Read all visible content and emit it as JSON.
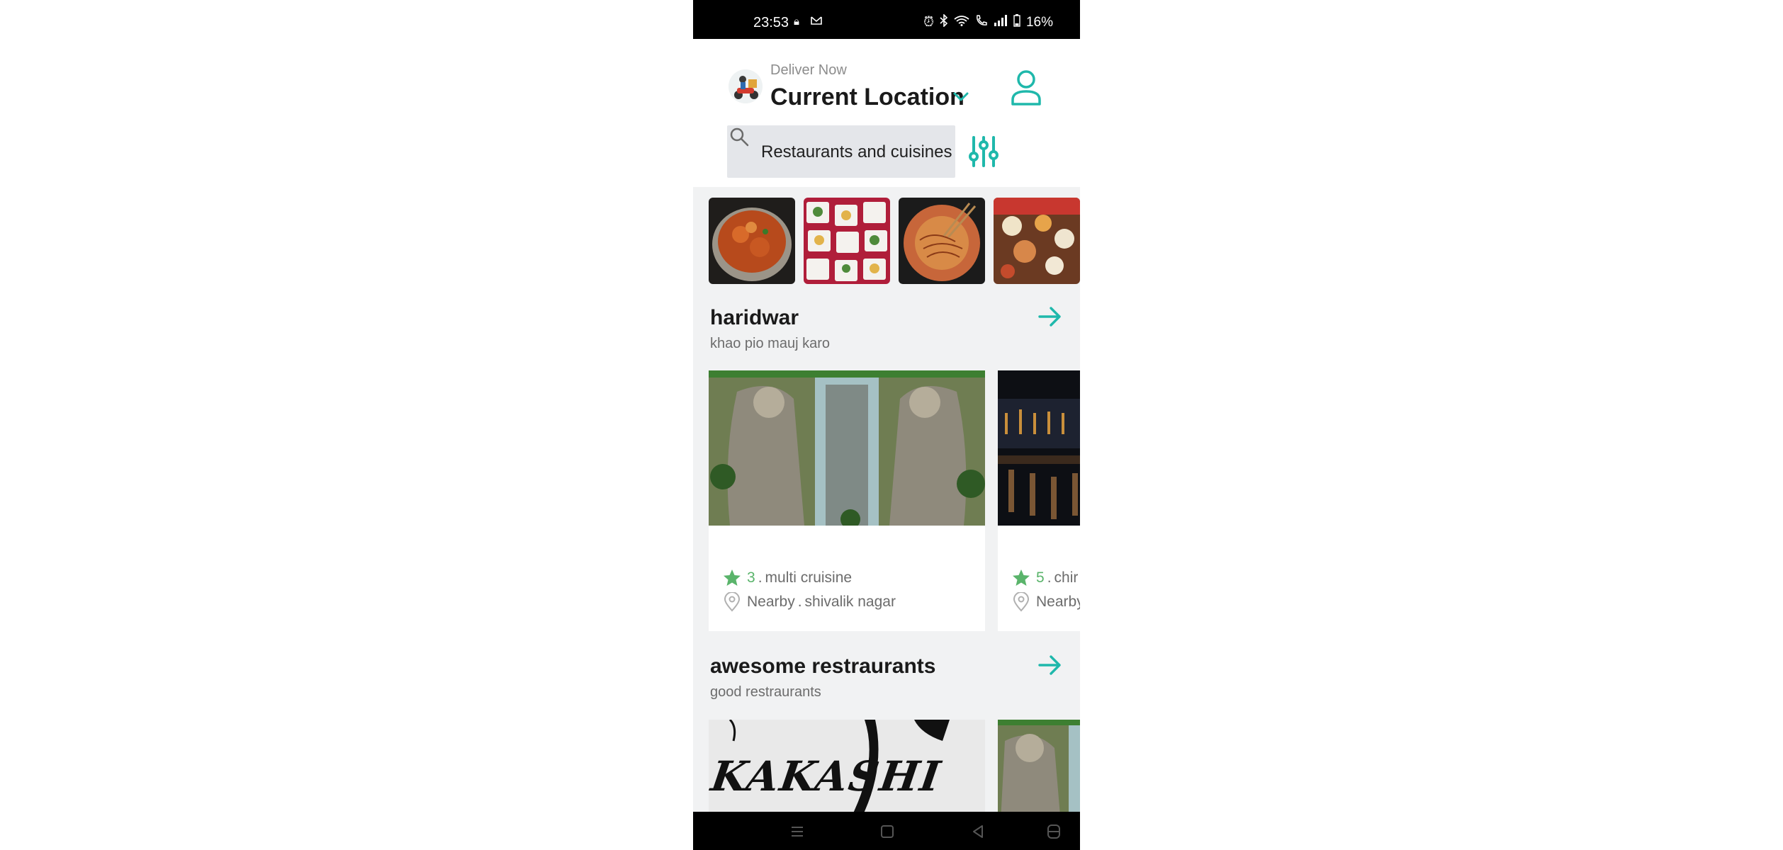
{
  "status_bar": {
    "time": "23:53",
    "battery": "16%",
    "icons": [
      "lock-icon",
      "mail-icon",
      "alarm-icon",
      "bluetooth-icon",
      "wifi-icon",
      "call-icon",
      "signal-icon",
      "battery-icon"
    ]
  },
  "header": {
    "deliver_label": "Deliver Now",
    "location": "Current Location"
  },
  "search": {
    "placeholder": "Restaurants and cuisines"
  },
  "colors": {
    "accent": "#1fb8ab",
    "rating_star": "#5ab46b",
    "background": "#f1f2f3"
  },
  "categories": [
    "curry-dish",
    "platter-dish",
    "noodle-dish",
    "thali-spread"
  ],
  "sections": [
    {
      "title": "haridwar",
      "subtitle": "khao pio mauj karo",
      "cards": [
        {
          "rating": "3",
          "cuisine": "multi cruisine",
          "distance": "Nearby",
          "area": "shivalik nagar"
        },
        {
          "rating": "5",
          "cuisine": "chir",
          "distance": "Nearby",
          "area": ""
        }
      ]
    },
    {
      "title": "awesome restraurants",
      "subtitle": "good restraurants",
      "cards": [
        {
          "logo_text": "KaKaSHi"
        }
      ]
    }
  ]
}
